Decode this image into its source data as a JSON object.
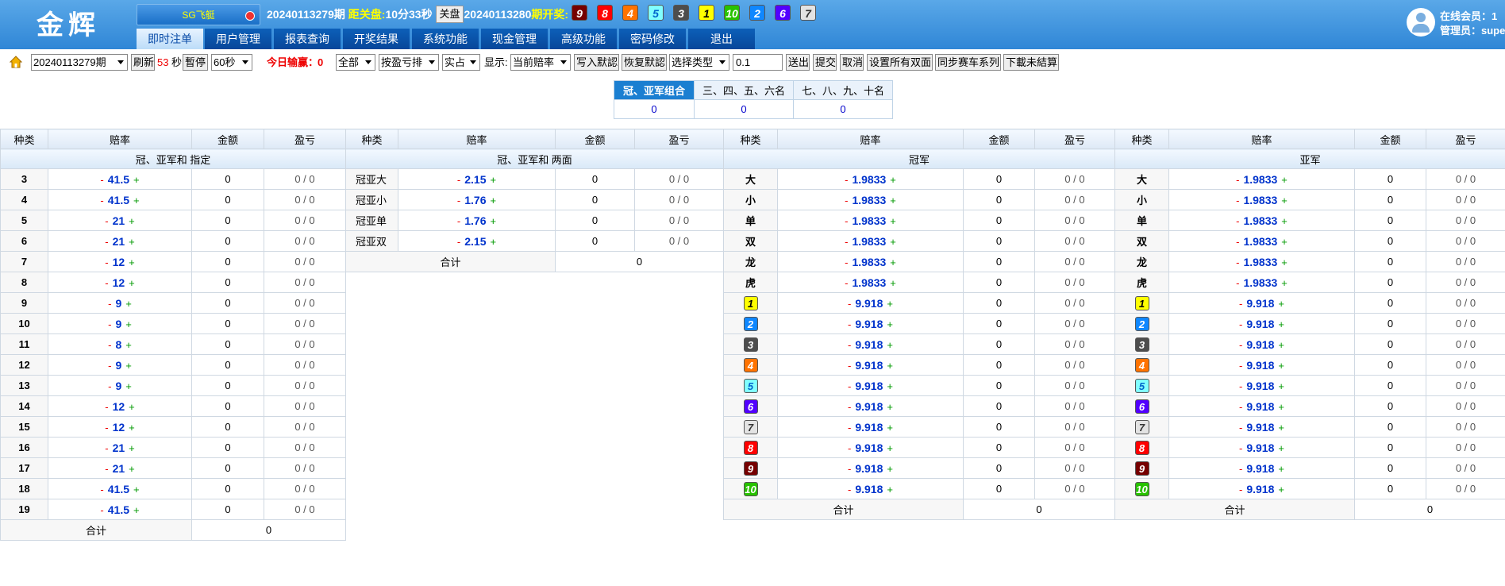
{
  "header": {
    "logo": "金辉",
    "game": "SG飞艇",
    "period_cur": "20240113279期",
    "countdown_label": "距关盘:",
    "countdown": "10分33秒",
    "close_button": "关盘",
    "period_next": "20240113280",
    "draw_label": "期开奖:",
    "draw_balls": [
      "9",
      "8",
      "4",
      "5",
      "3",
      "1",
      "10",
      "2",
      "6",
      "7"
    ],
    "user_online": "在线会员：1",
    "user_admin": "管理员：supe"
  },
  "nav": [
    "即时注单",
    "用户管理",
    "报表查询",
    "开奖结果",
    "系统功能",
    "现金管理",
    "高级功能",
    "密码修改",
    "退出"
  ],
  "toolbar": {
    "period_select": "20240113279期",
    "refresh": "刷新",
    "seconds": "53",
    "sec_unit": "秒",
    "pause": "暫停",
    "interval_select": "60秒",
    "today_label": "今日输赢：",
    "today_value": "0",
    "all_select": "全部",
    "sort_select": "按盈亏排",
    "real_select": "实占",
    "show_label": "显示:",
    "odds_select": "当前赔率",
    "write_default": "写入默認",
    "restore_default": "恢复默認",
    "type_select": "选择类型",
    "step_value": "0.1",
    "send": "送出",
    "submit": "提交",
    "cancel": "取消",
    "set_all": "设置所有双面",
    "sync": "同步赛车系列",
    "download": "下載未結算"
  },
  "summary": {
    "headers": [
      "冠、亚军组合",
      "三、四、五、六名",
      "七、八、九、十名"
    ],
    "values": [
      "0",
      "0",
      "0"
    ]
  },
  "grid": {
    "col_kind": "种类",
    "col_odds": "赔率",
    "col_amount": "金额",
    "col_pl": "盈亏",
    "total_label": "合计",
    "minus": "-",
    "plus": "+",
    "sec_sum_specified": "冠、亚军和 指定",
    "sec_sum_two_sides": "冠、亚军和 两面",
    "sec_champion": "冠军",
    "sec_runner": "亚军",
    "sum_rows": [
      {
        "kind": "3",
        "odds": "41.5",
        "amount": "0",
        "pl": "0 / 0"
      },
      {
        "kind": "4",
        "odds": "41.5",
        "amount": "0",
        "pl": "0 / 0"
      },
      {
        "kind": "5",
        "odds": "21",
        "amount": "0",
        "pl": "0 / 0"
      },
      {
        "kind": "6",
        "odds": "21",
        "amount": "0",
        "pl": "0 / 0"
      },
      {
        "kind": "7",
        "odds": "12",
        "amount": "0",
        "pl": "0 / 0"
      },
      {
        "kind": "8",
        "odds": "12",
        "amount": "0",
        "pl": "0 / 0"
      },
      {
        "kind": "9",
        "odds": "9",
        "amount": "0",
        "pl": "0 / 0"
      },
      {
        "kind": "10",
        "odds": "9",
        "amount": "0",
        "pl": "0 / 0"
      },
      {
        "kind": "11",
        "odds": "8",
        "amount": "0",
        "pl": "0 / 0"
      },
      {
        "kind": "12",
        "odds": "9",
        "amount": "0",
        "pl": "0 / 0"
      },
      {
        "kind": "13",
        "odds": "9",
        "amount": "0",
        "pl": "0 / 0"
      },
      {
        "kind": "14",
        "odds": "12",
        "amount": "0",
        "pl": "0 / 0"
      },
      {
        "kind": "15",
        "odds": "12",
        "amount": "0",
        "pl": "0 / 0"
      },
      {
        "kind": "16",
        "odds": "21",
        "amount": "0",
        "pl": "0 / 0"
      },
      {
        "kind": "17",
        "odds": "21",
        "amount": "0",
        "pl": "0 / 0"
      },
      {
        "kind": "18",
        "odds": "41.5",
        "amount": "0",
        "pl": "0 / 0"
      },
      {
        "kind": "19",
        "odds": "41.5",
        "amount": "0",
        "pl": "0 / 0"
      }
    ],
    "sum_total": "0",
    "two_sides_rows": [
      {
        "kind": "冠亚大",
        "odds": "2.15",
        "amount": "0",
        "pl": "0 / 0"
      },
      {
        "kind": "冠亚小",
        "odds": "1.76",
        "amount": "0",
        "pl": "0 / 0"
      },
      {
        "kind": "冠亚单",
        "odds": "1.76",
        "amount": "0",
        "pl": "0 / 0"
      },
      {
        "kind": "冠亚双",
        "odds": "2.15",
        "amount": "0",
        "pl": "0 / 0"
      }
    ],
    "two_sides_total": "0",
    "champion_rows": [
      {
        "kind": "大",
        "odds": "1.9833",
        "amount": "0",
        "pl": "0 / 0"
      },
      {
        "kind": "小",
        "odds": "1.9833",
        "amount": "0",
        "pl": "0 / 0"
      },
      {
        "kind": "单",
        "odds": "1.9833",
        "amount": "0",
        "pl": "0 / 0"
      },
      {
        "kind": "双",
        "odds": "1.9833",
        "amount": "0",
        "pl": "0 / 0"
      },
      {
        "kind": "龙",
        "odds": "1.9833",
        "amount": "0",
        "pl": "0 / 0"
      },
      {
        "kind": "虎",
        "odds": "1.9833",
        "amount": "0",
        "pl": "0 / 0"
      },
      {
        "kind": "1",
        "ball": true,
        "odds": "9.918",
        "amount": "0",
        "pl": "0 / 0"
      },
      {
        "kind": "2",
        "ball": true,
        "odds": "9.918",
        "amount": "0",
        "pl": "0 / 0"
      },
      {
        "kind": "3",
        "ball": true,
        "odds": "9.918",
        "amount": "0",
        "pl": "0 / 0"
      },
      {
        "kind": "4",
        "ball": true,
        "odds": "9.918",
        "amount": "0",
        "pl": "0 / 0"
      },
      {
        "kind": "5",
        "ball": true,
        "odds": "9.918",
        "amount": "0",
        "pl": "0 / 0"
      },
      {
        "kind": "6",
        "ball": true,
        "odds": "9.918",
        "amount": "0",
        "pl": "0 / 0"
      },
      {
        "kind": "7",
        "ball": true,
        "odds": "9.918",
        "amount": "0",
        "pl": "0 / 0"
      },
      {
        "kind": "8",
        "ball": true,
        "odds": "9.918",
        "amount": "0",
        "pl": "0 / 0"
      },
      {
        "kind": "9",
        "ball": true,
        "odds": "9.918",
        "amount": "0",
        "pl": "0 / 0"
      },
      {
        "kind": "10",
        "ball": true,
        "odds": "9.918",
        "amount": "0",
        "pl": "0 / 0"
      }
    ],
    "champion_total": "0",
    "runner_rows": [
      {
        "kind": "大",
        "odds": "1.9833",
        "amount": "0",
        "pl": "0 / 0"
      },
      {
        "kind": "小",
        "odds": "1.9833",
        "amount": "0",
        "pl": "0 / 0"
      },
      {
        "kind": "单",
        "odds": "1.9833",
        "amount": "0",
        "pl": "0 / 0"
      },
      {
        "kind": "双",
        "odds": "1.9833",
        "amount": "0",
        "pl": "0 / 0"
      },
      {
        "kind": "龙",
        "odds": "1.9833",
        "amount": "0",
        "pl": "0 / 0"
      },
      {
        "kind": "虎",
        "odds": "1.9833",
        "amount": "0",
        "pl": "0 / 0"
      },
      {
        "kind": "1",
        "ball": true,
        "odds": "9.918",
        "amount": "0",
        "pl": "0 / 0"
      },
      {
        "kind": "2",
        "ball": true,
        "odds": "9.918",
        "amount": "0",
        "pl": "0 / 0"
      },
      {
        "kind": "3",
        "ball": true,
        "odds": "9.918",
        "amount": "0",
        "pl": "0 / 0"
      },
      {
        "kind": "4",
        "ball": true,
        "odds": "9.918",
        "amount": "0",
        "pl": "0 / 0"
      },
      {
        "kind": "5",
        "ball": true,
        "odds": "9.918",
        "amount": "0",
        "pl": "0 / 0"
      },
      {
        "kind": "6",
        "ball": true,
        "odds": "9.918",
        "amount": "0",
        "pl": "0 / 0"
      },
      {
        "kind": "7",
        "ball": true,
        "odds": "9.918",
        "amount": "0",
        "pl": "0 / 0"
      },
      {
        "kind": "8",
        "ball": true,
        "odds": "9.918",
        "amount": "0",
        "pl": "0 / 0"
      },
      {
        "kind": "9",
        "ball": true,
        "odds": "9.918",
        "amount": "0",
        "pl": "0 / 0"
      },
      {
        "kind": "10",
        "ball": true,
        "odds": "9.918",
        "amount": "0",
        "pl": "0 / 0"
      }
    ],
    "runner_total": "0"
  }
}
